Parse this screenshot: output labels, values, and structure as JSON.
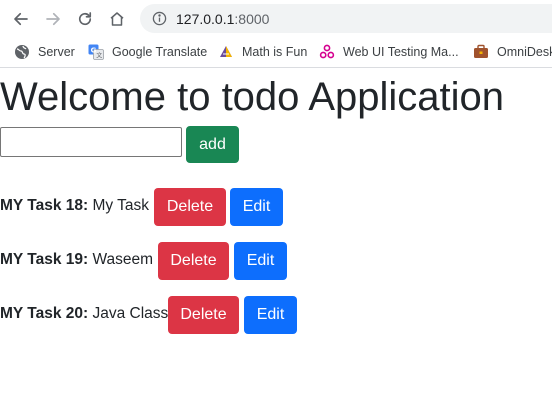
{
  "browser": {
    "url_host": "127.0.0.1",
    "url_port": ":8000",
    "bookmarks": [
      {
        "label": "Server",
        "icon": "globe-icon"
      },
      {
        "label": "Google Translate",
        "icon": "google-translate-icon"
      },
      {
        "label": "Math is Fun",
        "icon": "math-is-fun-icon"
      },
      {
        "label": "Web UI Testing Ma...",
        "icon": "web-ui-testing-icon"
      },
      {
        "label": "OmniDesk",
        "icon": "omnidesk-icon"
      }
    ]
  },
  "app": {
    "title": "Welcome to todo Application",
    "input_value": "",
    "add_label": "add",
    "tasks": [
      {
        "prefix": "MY Task 18:",
        "text": "My Task",
        "delete_label": "Delete",
        "edit_label": "Edit"
      },
      {
        "prefix": "MY Task 19:",
        "text": "Waseem",
        "delete_label": "Delete",
        "edit_label": "Edit"
      },
      {
        "prefix": "MY Task 20:",
        "text": "Java Class",
        "delete_label": "Delete",
        "edit_label": "Edit"
      }
    ]
  },
  "colors": {
    "add": "#198754",
    "delete": "#dc3545",
    "edit": "#0d6efd"
  }
}
